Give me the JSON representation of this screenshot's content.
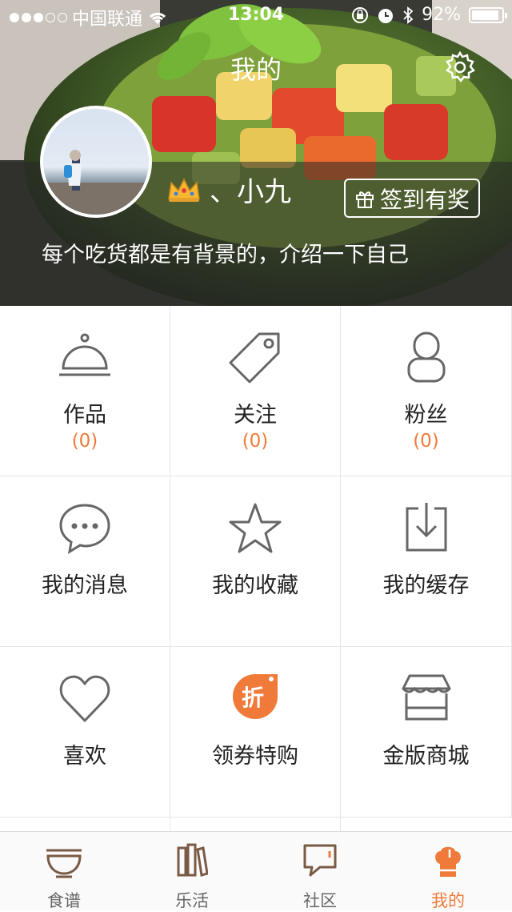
{
  "status_bar": {
    "carrier": "中国联通",
    "time": "13:04",
    "battery": "92%",
    "battery_level": 0.92,
    "signal_bars_filled": 3,
    "signal_bars_total": 5
  },
  "header": {
    "title": "我的",
    "username": "、小九",
    "checkin_label": "签到有奖",
    "bio": "每个吃货都是有背景的，介绍一下自己"
  },
  "grid": [
    {
      "label": "作品",
      "count": "(0)",
      "icon": "dish-cloche-icon"
    },
    {
      "label": "关注",
      "count": "(0)",
      "icon": "tag-icon"
    },
    {
      "label": "粉丝",
      "count": "(0)",
      "icon": "person-icon"
    },
    {
      "label": "我的消息",
      "icon": "chat-bubble-icon"
    },
    {
      "label": "我的收藏",
      "icon": "star-icon"
    },
    {
      "label": "我的缓存",
      "icon": "download-icon"
    },
    {
      "label": "喜欢",
      "icon": "heart-icon"
    },
    {
      "label": "领券特购",
      "icon": "discount-badge-icon",
      "badge_char": "折"
    },
    {
      "label": "金版商城",
      "icon": "shop-icon"
    }
  ],
  "tabs": [
    {
      "label": "食谱",
      "icon": "bowl-icon"
    },
    {
      "label": "乐活",
      "icon": "books-icon"
    },
    {
      "label": "社区",
      "icon": "speech-icon"
    },
    {
      "label": "我的",
      "icon": "chef-hat-icon",
      "active": true
    }
  ],
  "colors": {
    "accent": "#f07a3a",
    "icon_gray": "#666666",
    "divider": "#e6e6e6"
  }
}
